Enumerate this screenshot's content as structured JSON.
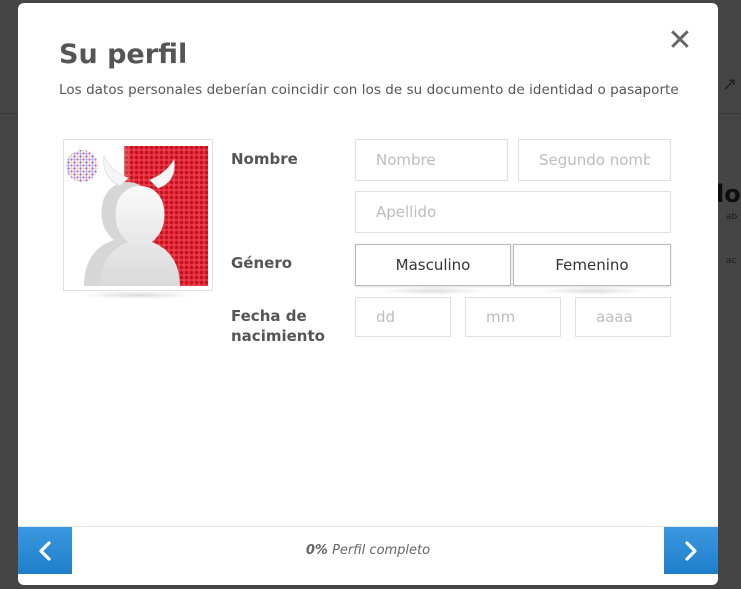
{
  "background": {
    "heading": "lo",
    "small1": "ab",
    "small2": "ac"
  },
  "modal": {
    "title": "Su perfil",
    "subtitle": "Los datos personales deberían coincidir con los de su documento de identidad o pasaporte",
    "close_icon": "close-icon"
  },
  "form": {
    "name_label": "Nombre",
    "first_name_placeholder": "Nombre",
    "second_name_placeholder": "Segundo nombre",
    "last_name_placeholder": "Apellido",
    "gender_label": "Género",
    "gender_options": [
      "Masculino",
      "Femenino"
    ],
    "dob_label_line1": "Fecha de",
    "dob_label_line2": "nacimiento",
    "day_placeholder": "dd",
    "month_placeholder": "mm",
    "year_placeholder": "aaaa"
  },
  "footer": {
    "progress_percent": "0%",
    "progress_label": "Perfil completo",
    "prev_icon": "chevron-left-icon",
    "next_icon": "chevron-right-icon"
  },
  "colors": {
    "accent_blue": "#2a8bd6",
    "avatar_red": "#d81d2c",
    "text_dark": "#555555"
  }
}
